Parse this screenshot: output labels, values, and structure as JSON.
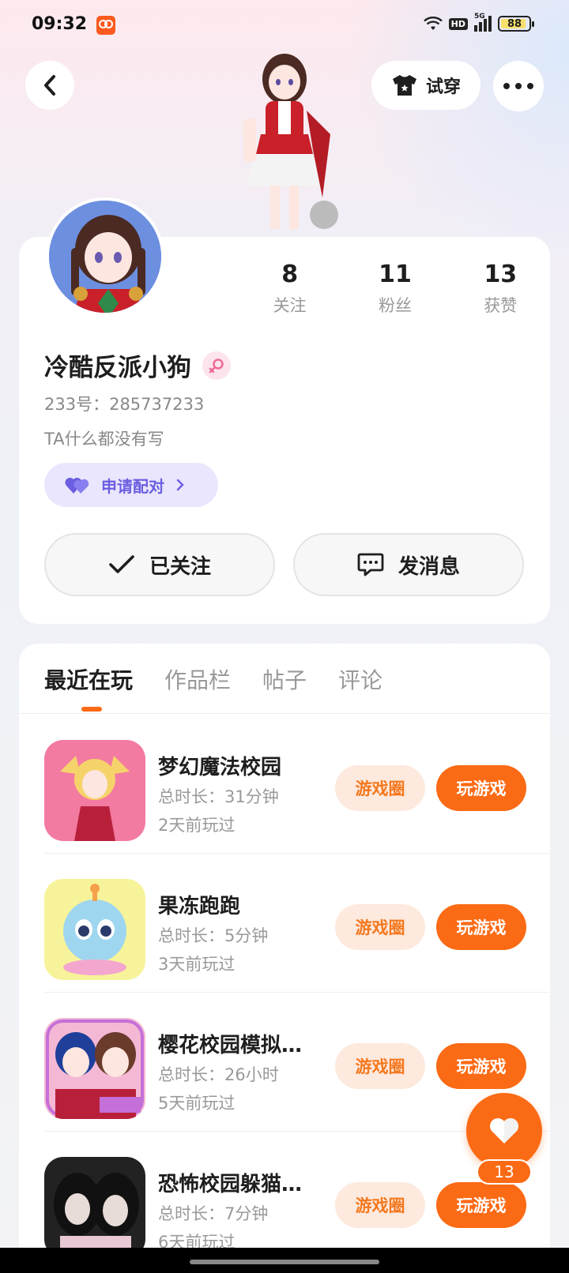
{
  "status_bar": {
    "time": "09:32",
    "battery": "88"
  },
  "header": {
    "tryon_label": "试穿"
  },
  "profile": {
    "stats": [
      {
        "count": "8",
        "label": "关注"
      },
      {
        "count": "11",
        "label": "粉丝"
      },
      {
        "count": "13",
        "label": "获赞"
      }
    ],
    "username": "冷酷反派小狗",
    "uid": "233号：285737233",
    "bio": "TA什么都没有写",
    "match_label": "申请配对",
    "follow_label": "已关注",
    "message_label": "发消息"
  },
  "tabs": [
    {
      "label": "最近在玩"
    },
    {
      "label": "作品栏"
    },
    {
      "label": "帖子"
    },
    {
      "label": "评论"
    }
  ],
  "games": [
    {
      "title": "梦幻魔法校园",
      "time": "总时长：31分钟",
      "last": "2天前玩过"
    },
    {
      "title": "果冻跑跑",
      "time": "总时长：5分钟",
      "last": "3天前玩过"
    },
    {
      "title": "樱花校园模拟…",
      "time": "总时长：26小时",
      "last": "5天前玩过"
    },
    {
      "title": "恐怖校园躲猫…",
      "time": "总时长：7分钟",
      "last": "6天前玩过"
    }
  ],
  "game_buttons": {
    "circle": "游戏圈",
    "play": "玩游戏"
  },
  "like": {
    "count": "13"
  },
  "colors": {
    "accent": "#fb6a14",
    "match": "#6b5ee0"
  }
}
